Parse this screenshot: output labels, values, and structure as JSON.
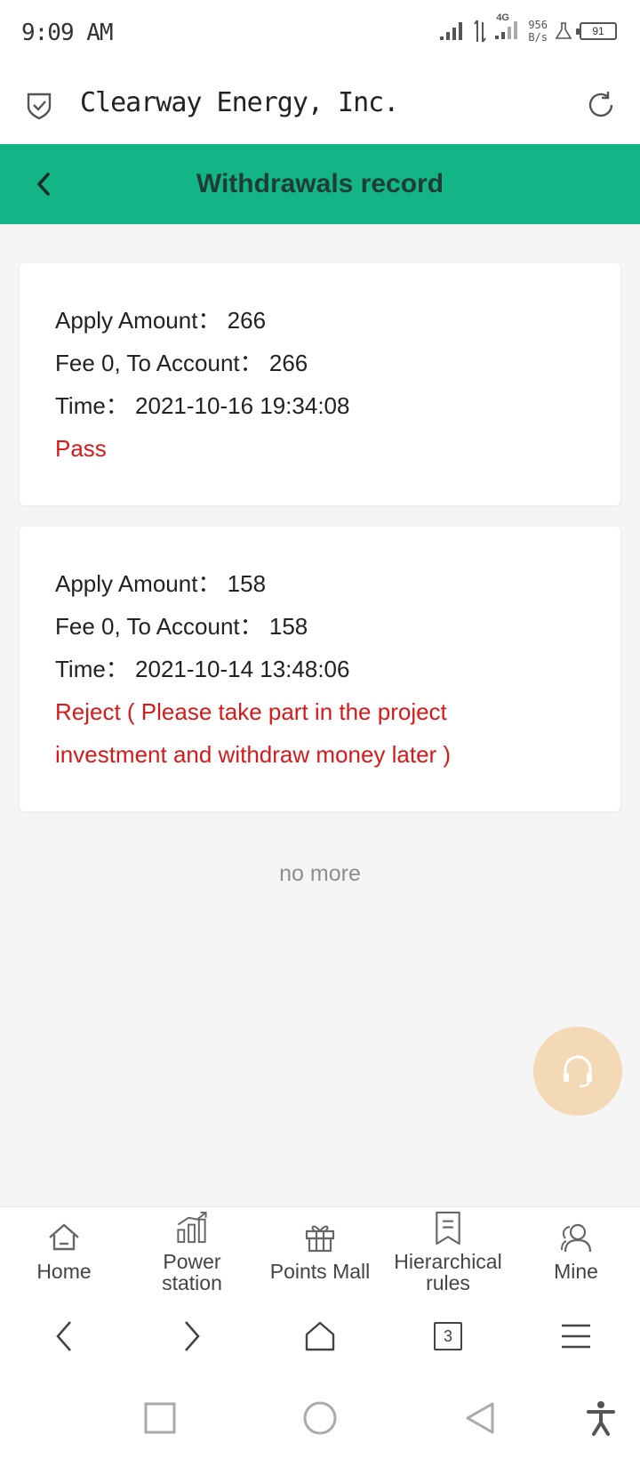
{
  "status_bar": {
    "time": "9:09 AM",
    "network": "4G",
    "speed_value": "956",
    "speed_unit": "B/s",
    "battery": "91"
  },
  "browser": {
    "title": "Clearway Energy, Inc."
  },
  "header": {
    "title": "Withdrawals record"
  },
  "records": [
    {
      "apply_amount": "Apply Amount：  266",
      "fee_line": "Fee 0, To Account：  266",
      "time": "Time：  2021-10-16 19:34:08",
      "status": "Pass"
    },
    {
      "apply_amount": "Apply Amount：  158",
      "fee_line": "Fee 0, To Account：  158",
      "time": "Time：  2021-10-14 13:48:06",
      "status_line1": "Reject ( Please take part in the project",
      "status_line2": "investment and withdraw money later )"
    }
  ],
  "list_end": "no more",
  "tabbar": {
    "items": [
      {
        "label": "Home"
      },
      {
        "label": "Power station"
      },
      {
        "label": "Points Mall"
      },
      {
        "label": "Hierarchical rules"
      },
      {
        "label": "Mine"
      }
    ]
  },
  "browser_nav": {
    "tabs_count": "3"
  },
  "colors": {
    "header_bg": "#13b586",
    "status_red": "#d81919",
    "service_bg": "#f3d9b5"
  }
}
